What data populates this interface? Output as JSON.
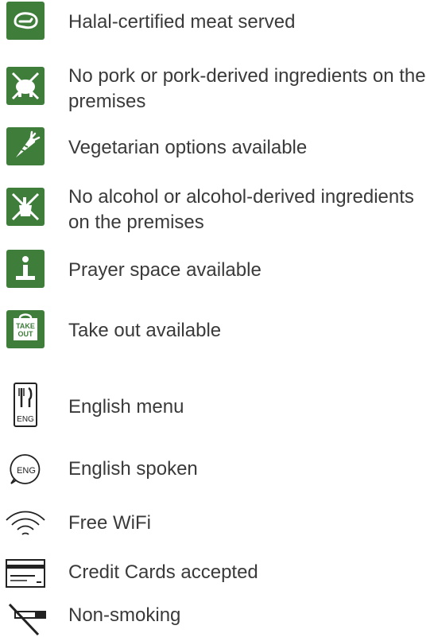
{
  "colors": {
    "accent": "#3f7d3b",
    "text": "#3a3a3a",
    "outline_icon": "#222222"
  },
  "features": [
    {
      "icon": "halal-meat-icon",
      "label": "Halal-certified meat served"
    },
    {
      "icon": "no-pork-icon",
      "label": "No pork or pork-derived ingredients on the premises"
    },
    {
      "icon": "vegetarian-carrot-icon",
      "label": "Vegetarian options available"
    },
    {
      "icon": "no-alcohol-icon",
      "label": "No alcohol or alcohol-derived ingredients on the premises"
    },
    {
      "icon": "prayer-space-icon",
      "label": "Prayer space available"
    },
    {
      "icon": "take-out-icon",
      "label": "Take out available",
      "icon_text_1": "TAKE",
      "icon_text_2": "OUT"
    },
    {
      "icon": "english-menu-icon",
      "label": "English menu",
      "icon_text": "ENG"
    },
    {
      "icon": "english-spoken-icon",
      "label": "English spoken",
      "icon_text": "ENG"
    },
    {
      "icon": "wifi-icon",
      "label": "Free WiFi"
    },
    {
      "icon": "credit-card-icon",
      "label": "Credit Cards accepted"
    },
    {
      "icon": "no-smoking-icon",
      "label": "Non-smoking"
    }
  ]
}
